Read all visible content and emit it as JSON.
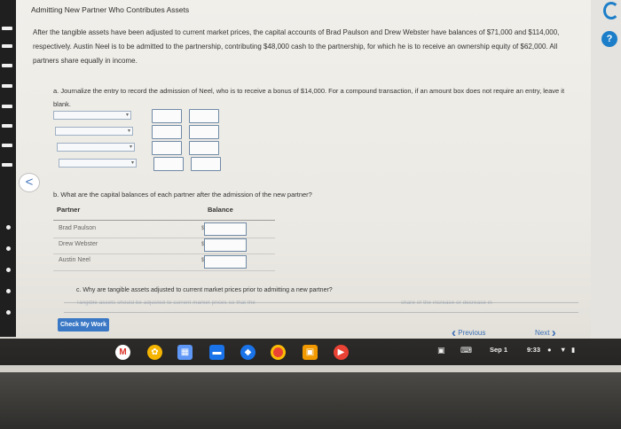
{
  "title": "Admitting New Partner Who Contributes Assets",
  "intro": "After the tangible assets have been adjusted to current market prices, the capital accounts of Brad Paulson and Drew Webster have balances of $71,000 and $114,000, respectively. Austin Neel is to be admitted to the partnership, contributing $48,000 cash to the partnership, for which he is to receive an ownership equity of $62,000. All partners share equally in income.",
  "part_a": "a. Journalize the entry to record the admission of Neel, who is to receive a bonus of $14,000. For a compound transaction, if an amount box does not require an entry, leave it blank.",
  "part_b": "b. What are the capital balances of each partner after the admission of the new partner?",
  "table": {
    "col_partner": "Partner",
    "col_balance": "Balance",
    "currency": "$",
    "rows": [
      {
        "partner": "Brad Paulson",
        "balance": ""
      },
      {
        "partner": "Drew Webster",
        "balance": ""
      },
      {
        "partner": "Austin Neel",
        "balance": ""
      }
    ]
  },
  "part_c": "c. Why are tangible assets adjusted to current market prices prior to admitting a new partner?",
  "answer_left": "Tangible assets should be adjusted to current market prices so that the",
  "answer_right": "share of the increase or decrease in",
  "buttons": {
    "check": "Check My Work",
    "previous": "Previous",
    "next": "Next",
    "back_glyph": "<",
    "help_glyph": "?"
  },
  "tray": {
    "date": "Sep 1",
    "time": "9:33"
  },
  "colors": {
    "accent": "#3a78c5",
    "help": "#1c7ec9"
  }
}
